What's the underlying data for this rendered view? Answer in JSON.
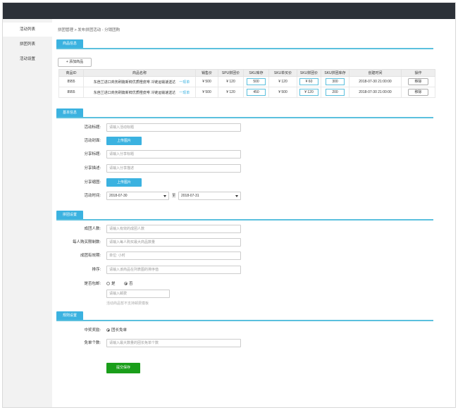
{
  "sidebar": {
    "items": [
      {
        "label": "活动列表"
      },
      {
        "label": "拼团列表"
      },
      {
        "label": "活动设置"
      }
    ]
  },
  "breadcrumb": "拼团管理 > 发布拼团活动 - 分销团购",
  "sections": {
    "goods": "商品信息",
    "basic": "基本信息",
    "group": "拼团设置",
    "rule": "规则设置"
  },
  "goods": {
    "add_button": "+ 添加商品",
    "columns": [
      "商品ID",
      "商品名称",
      "销售价",
      "SPU拼团价",
      "SKU库存",
      "SKU单买价",
      "SKU拼团价",
      "SKU拼团库存",
      "创建时间",
      "操作"
    ],
    "rows": [
      {
        "id": "8955",
        "name": "东芭兰进口商务刷篇新鲜优质橙皮啡 冷链运输速送达",
        "link": "一现单",
        "price": "¥ 500",
        "spu": "¥ 120",
        "stock": "500",
        "single": "¥ 120",
        "group": "¥ 60",
        "group_stock": "300",
        "time": "2018-07-30 21:00:00",
        "action": "移除"
      },
      {
        "id": "8955",
        "name": "东芭兰进口商务刷篇新鲜优质橙皮啡 冷链运输速送达",
        "link": "一现单",
        "price": "¥ 500",
        "spu": "¥ 120",
        "stock": "450",
        "single": "¥ 500",
        "group": "¥ 120",
        "group_stock": "200",
        "time": "2018-07-30 21:00:00",
        "action": "移除"
      }
    ]
  },
  "basic": {
    "title_label": "活动标题:",
    "title_placeholder": "请输入活动标题",
    "cover_label": "活动封面:",
    "upload": "上传图片",
    "share_title_label": "分享标题:",
    "share_title_placeholder": "请输入分享标题",
    "share_desc_label": "分享描述:",
    "share_desc_placeholder": "请输入分享描述",
    "share_img_label": "分享缩图:",
    "time_label": "活动时间:",
    "start_date": "2018-07-30",
    "to": "至",
    "end_date": "2018-07-31"
  },
  "group": {
    "size_label": "成团人数:",
    "size_placeholder": "请输入有效的成团人数",
    "limit_label": "每人购买限制数:",
    "limit_placeholder": "请输入每人购买最大商品数量",
    "valid_label": "成团有效期:",
    "valid_placeholder": "单位: 小时",
    "sort_label": "排序:",
    "sort_placeholder": "请输入该商品在列表图的排序值",
    "ship_label": "是否包邮:",
    "ship_yes": "是",
    "ship_no": "否",
    "postage_placeholder": "请输入邮费",
    "ship_hint": "活动商品暂不支持邮费模板"
  },
  "rule": {
    "reward_label": "中奖奖励:",
    "reward_option": "团长免单",
    "free_label": "免单个数:",
    "free_placeholder": "请输入最大数量的团长免单个数"
  },
  "submit": "提交保存"
}
